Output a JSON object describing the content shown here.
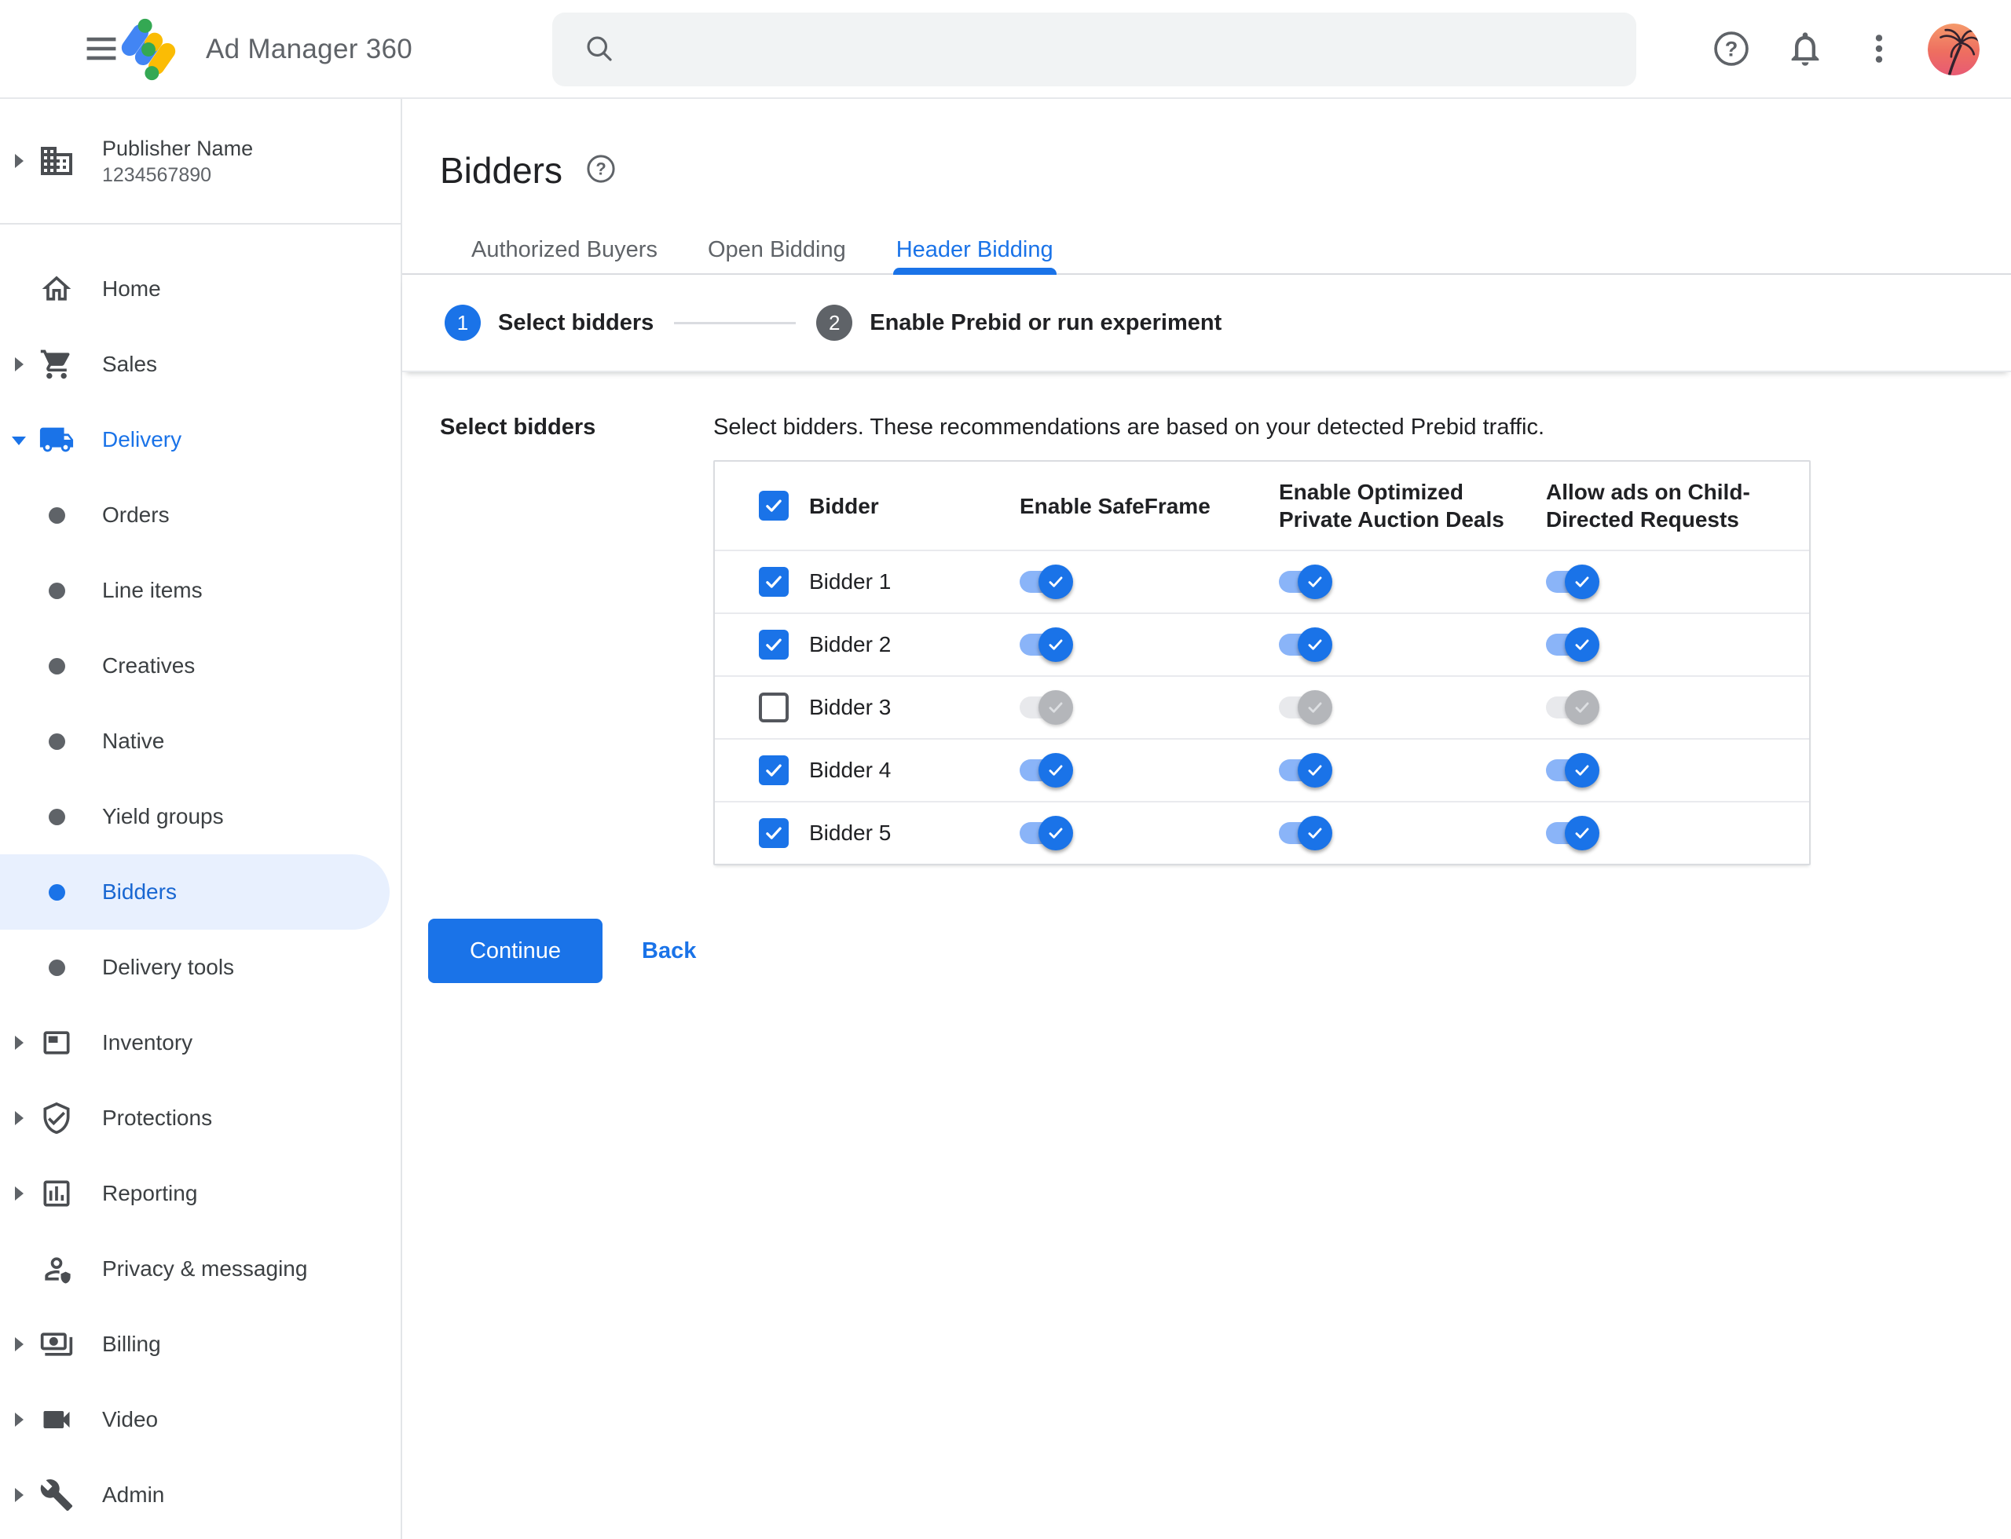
{
  "topbar": {
    "product_name": "Ad Manager 360",
    "icons": {
      "menu": "hamburger-icon",
      "search": "search-icon",
      "help": "help-icon",
      "notifications": "bell-icon",
      "more": "kebab-icon",
      "account": "avatar-palm-tree"
    }
  },
  "sidebar": {
    "publisher": {
      "name": "Publisher Name",
      "id": "1234567890"
    },
    "items": [
      {
        "label": "Home",
        "icon": "home-icon"
      },
      {
        "label": "Sales",
        "icon": "cart-icon",
        "expandable": true
      },
      {
        "label": "Delivery",
        "icon": "truck-icon",
        "expandable": true,
        "expanded": true
      },
      {
        "label": "Orders",
        "icon": "bullet-icon"
      },
      {
        "label": "Line items",
        "icon": "bullet-icon"
      },
      {
        "label": "Creatives",
        "icon": "bullet-icon"
      },
      {
        "label": "Native",
        "icon": "bullet-icon"
      },
      {
        "label": "Yield groups",
        "icon": "bullet-icon"
      },
      {
        "label": "Bidders",
        "icon": "bullet-icon",
        "active": true
      },
      {
        "label": "Delivery tools",
        "icon": "bullet-icon"
      },
      {
        "label": "Inventory",
        "icon": "inventory-icon",
        "expandable": true
      },
      {
        "label": "Protections",
        "icon": "shield-check-icon",
        "expandable": true
      },
      {
        "label": "Reporting",
        "icon": "bar-chart-icon",
        "expandable": true
      },
      {
        "label": "Privacy & messaging",
        "icon": "person-shield-icon"
      },
      {
        "label": "Billing",
        "icon": "payments-icon",
        "expandable": true
      },
      {
        "label": "Video",
        "icon": "videocam-icon",
        "expandable": true
      },
      {
        "label": "Admin",
        "icon": "wrench-icon",
        "expandable": true
      }
    ]
  },
  "page": {
    "title": "Bidders",
    "tabs": [
      {
        "label": "Authorized Buyers",
        "active": false
      },
      {
        "label": "Open Bidding",
        "active": false
      },
      {
        "label": "Header Bidding",
        "active": true
      }
    ],
    "steps": [
      {
        "number": "1",
        "label": "Select bidders",
        "active": true
      },
      {
        "number": "2",
        "label": "Enable Prebid or run experiment",
        "active": false
      }
    ],
    "section_label": "Select bidders",
    "description": "Select bidders. These recommendations are based on your detected Prebid traffic.",
    "table": {
      "select_all": true,
      "headers": [
        "Bidder",
        "Enable SafeFrame",
        "Enable Optimized\nPrivate Auction Deals",
        "Allow ads on Child-\nDirected Requests"
      ],
      "rows": [
        {
          "name": "Bidder 1",
          "selected": true,
          "enable_safeframe": true,
          "enable_optimized_deals": true,
          "allow_child_directed": true
        },
        {
          "name": "Bidder 2",
          "selected": true,
          "enable_safeframe": true,
          "enable_optimized_deals": true,
          "allow_child_directed": true
        },
        {
          "name": "Bidder 3",
          "selected": false,
          "enable_safeframe": false,
          "enable_optimized_deals": false,
          "allow_child_directed": false
        },
        {
          "name": "Bidder 4",
          "selected": true,
          "enable_safeframe": true,
          "enable_optimized_deals": true,
          "allow_child_directed": true
        },
        {
          "name": "Bidder 5",
          "selected": true,
          "enable_safeframe": true,
          "enable_optimized_deals": true,
          "allow_child_directed": true
        }
      ]
    },
    "continue_label": "Continue",
    "back_label": "Back"
  },
  "colors": {
    "accent_blue": "#1a73e8",
    "toggle_track_on": "#8ab4f8",
    "toggle_off_thumb": "#b4b6ba",
    "selected_nav_bg": "#e8f0fe",
    "logo_blue": "#4285f4",
    "logo_yellow": "#fbbc04",
    "logo_green": "#34a853"
  }
}
